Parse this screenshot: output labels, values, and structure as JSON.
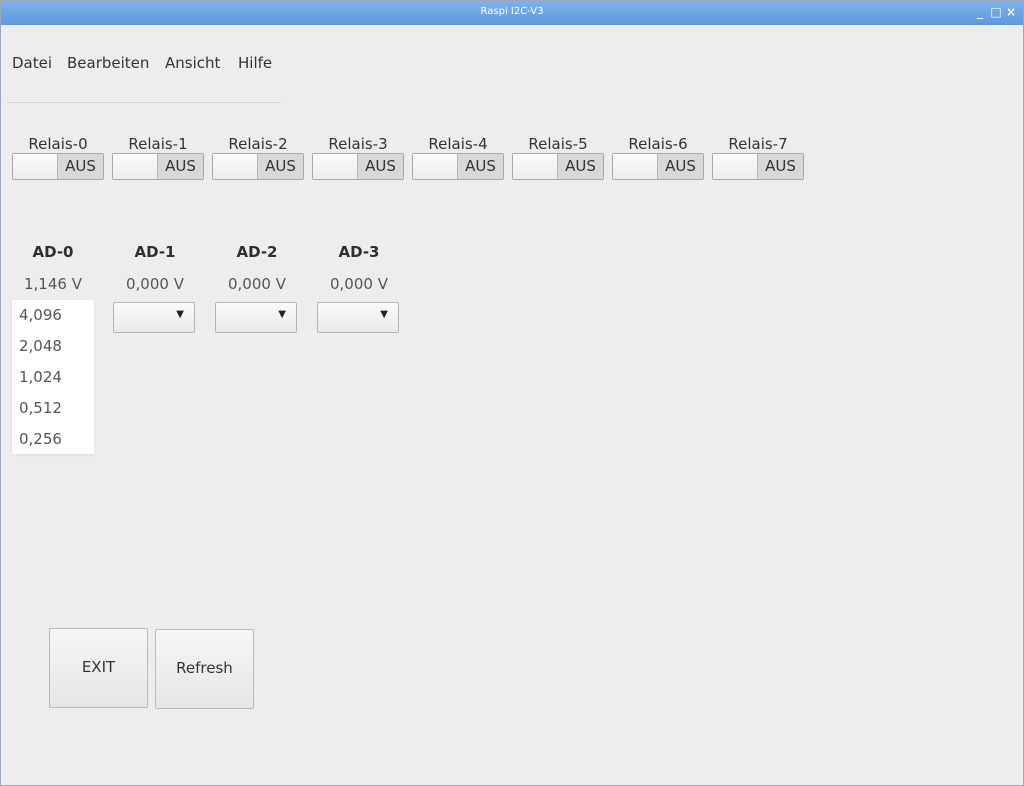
{
  "window": {
    "title": "Raspi I2C-V3",
    "controls": {
      "minimize": "_",
      "maximize": "□",
      "close": "×"
    }
  },
  "menu": {
    "items": [
      {
        "label": "Datei"
      },
      {
        "label": "Bearbeiten"
      },
      {
        "label": "Ansicht"
      },
      {
        "label": "Hilfe"
      }
    ]
  },
  "relays": [
    {
      "label": "Relais-0",
      "state": "AUS"
    },
    {
      "label": "Relais-1",
      "state": "AUS"
    },
    {
      "label": "Relais-2",
      "state": "AUS"
    },
    {
      "label": "Relais-3",
      "state": "AUS"
    },
    {
      "label": "Relais-4",
      "state": "AUS"
    },
    {
      "label": "Relais-5",
      "state": "AUS"
    },
    {
      "label": "Relais-6",
      "state": "AUS"
    },
    {
      "label": "Relais-7",
      "state": "AUS"
    }
  ],
  "adc": [
    {
      "label": "AD-0",
      "value": "1,146 V"
    },
    {
      "label": "AD-1",
      "value": "0,000 V"
    },
    {
      "label": "AD-2",
      "value": "0,000 V"
    },
    {
      "label": "AD-3",
      "value": "0,000 V"
    }
  ],
  "gain_dropdown": {
    "open_for": "AD-0",
    "options": [
      "4,096",
      "2,048",
      "1,024",
      "0,512",
      "0,256"
    ]
  },
  "buttons": {
    "exit": "EXIT",
    "refresh": "Refresh"
  },
  "icons": {
    "dropdown_arrow": "▼"
  },
  "colors": {
    "titlebar": "#6aa3e4",
    "window_bg": "#ededed",
    "switch_off": "#d8d8d8"
  }
}
